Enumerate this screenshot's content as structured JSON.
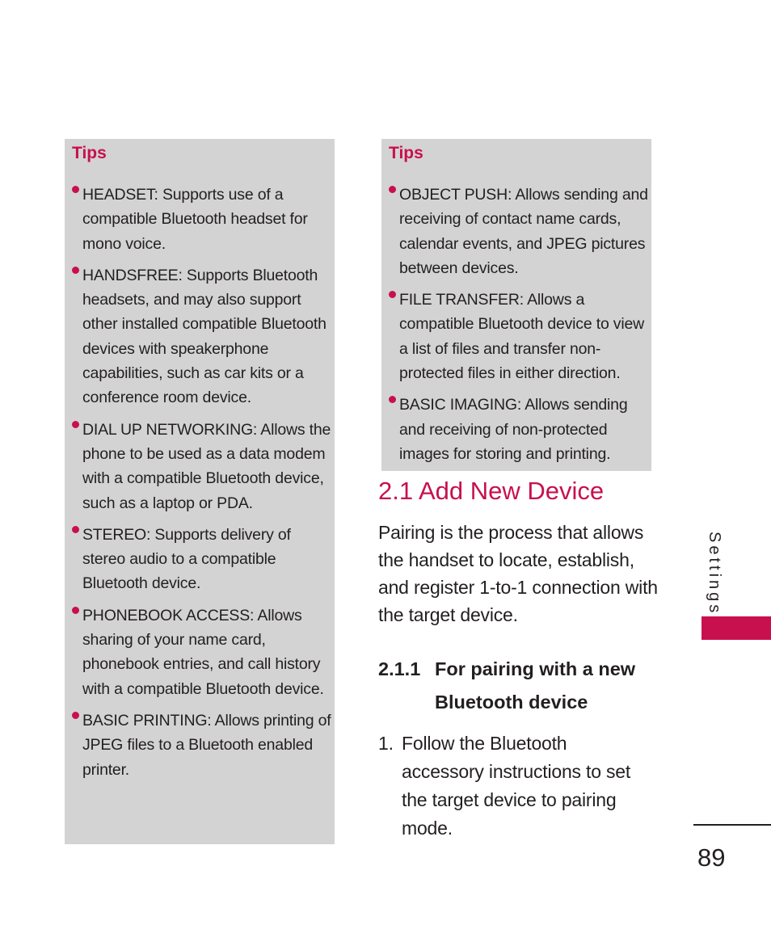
{
  "tips_left": {
    "title": "Tips",
    "items": [
      "HEADSET: Supports use of a compatible Bluetooth headset for mono voice.",
      "HANDSFREE: Supports Bluetooth headsets, and may also support other installed compatible Bluetooth devices with speakerphone capabilities, such as car kits or a conference room device.",
      "DIAL UP NETWORKING: Allows the phone to be used as a data modem with a compatible Bluetooth device, such as a laptop or PDA.",
      "STEREO: Supports delivery of stereo audio to a compatible Bluetooth device.",
      "PHONEBOOK ACCESS: Allows sharing of your name card, phonebook entries, and call history with a compatible Bluetooth device.",
      "BASIC PRINTING: Allows printing of JPEG files to a Bluetooth enabled printer."
    ]
  },
  "tips_right": {
    "title": "Tips",
    "items": [
      "OBJECT PUSH: Allows sending and receiving of contact name cards, calendar events, and JPEG pictures between devices.",
      "FILE TRANSFER: Allows a compatible Bluetooth device to view a list of files and transfer non-protected files in either direction.",
      "BASIC IMAGING: Allows sending and receiving of non-protected images for storing and printing."
    ]
  },
  "section": {
    "title": "2.1 Add New Device",
    "body": "Pairing is the process that allows the handset to locate, establish, and register 1-to-1 connection with the target device.",
    "subsection": {
      "number": "2.1.1",
      "title_line1": "For pairing with a new",
      "title_line2": "Bluetooth device"
    },
    "steps": [
      {
        "number": "1.",
        "text": "Follow the Bluetooth accessory instructions to set the target device to pairing mode."
      }
    ]
  },
  "side_tab": {
    "label": "Settings",
    "color": "#c8104e"
  },
  "page_number": "89",
  "colors": {
    "accent": "#c8104e",
    "tips_bg": "#d3d3d3",
    "text": "#231f20"
  }
}
